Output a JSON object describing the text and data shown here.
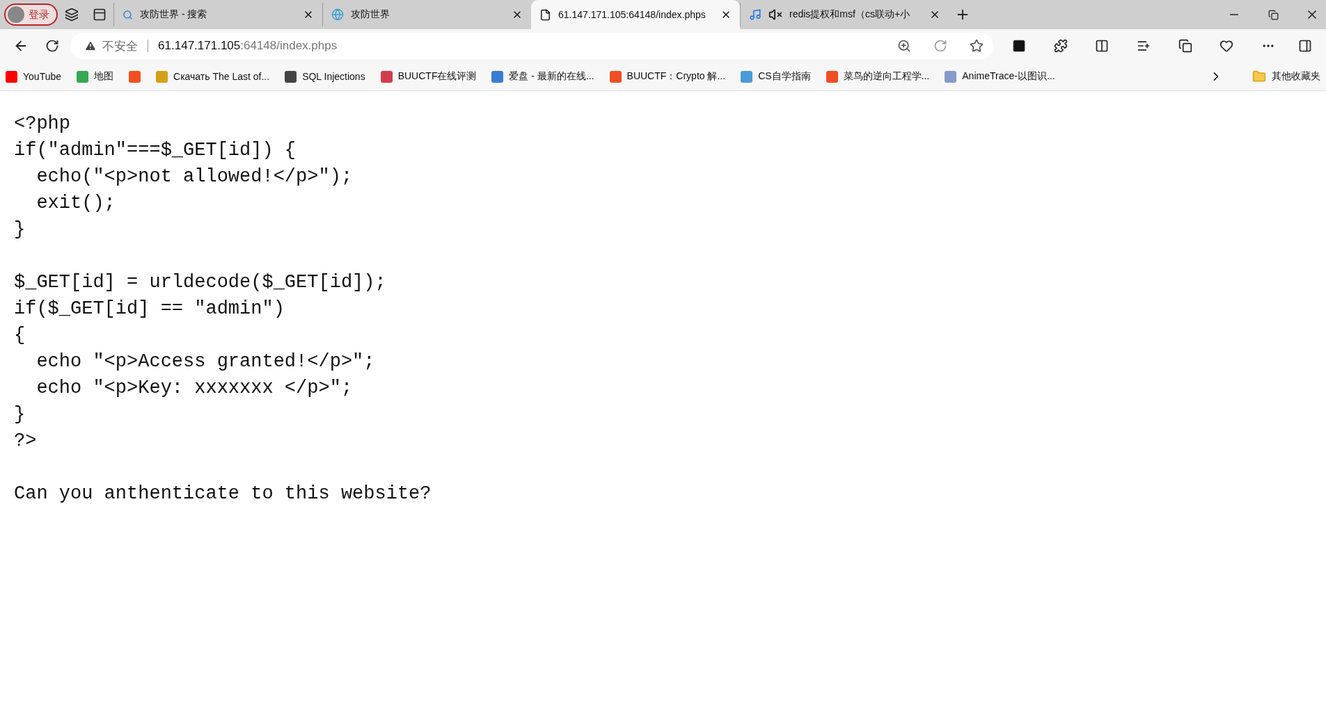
{
  "profile": {
    "label": "登录"
  },
  "tabs": [
    {
      "title": "攻防世界 - 搜索",
      "kind": "search",
      "selected": false,
      "muted": false
    },
    {
      "title": "攻防世界",
      "kind": "globe",
      "selected": false,
      "muted": false
    },
    {
      "title": "61.147.171.105:64148/index.phps",
      "kind": "page",
      "selected": true,
      "muted": false
    },
    {
      "title": "redis提权和msf（cs联动+小",
      "kind": "media",
      "selected": false,
      "muted": true
    }
  ],
  "address_bar": {
    "security": "不安全",
    "host": "61.147.171.105",
    "path": ":64148/index.phps"
  },
  "bookmarks": [
    {
      "label": "YouTube",
      "color": "#ff0000"
    },
    {
      "label": "地图",
      "color": "#34a853"
    },
    {
      "color": "#f25022"
    },
    {
      "label": "Скачать The Last of...",
      "color": "#d4a017"
    },
    {
      "label": "SQL Injections",
      "color": "#444444"
    },
    {
      "label": "BUUCTF在线评测",
      "color": "#d23c4c"
    },
    {
      "label": "爱盘 - 最新的在线...",
      "color": "#3a7bd5"
    },
    {
      "label": "BUUCTF：Crypto 解...",
      "color": "#f04e23"
    },
    {
      "label": "CS自学指南",
      "color": "#4a9bd8"
    },
    {
      "label": "菜鸟的逆向工程学...",
      "color": "#f04e23"
    },
    {
      "label": "AnimeTrace-以图识...",
      "color": "#8899cc"
    }
  ],
  "other_bookmarks": "其他收藏夹",
  "code_blocks": [
    {
      "lines": [
        "<?php",
        "if(\"admin\"===$_GET[id]) {",
        "  echo(\"<p>not allowed!</p>\");",
        "  exit();",
        "}"
      ]
    },
    {
      "lines": [
        "$_GET[id] = urldecode($_GET[id]);",
        "if($_GET[id] == \"admin\")",
        "{",
        "  echo \"<p>Access granted!</p>\";",
        "  echo \"<p>Key: xxxxxxx </p>\";",
        "}",
        "?>"
      ]
    }
  ],
  "message": "Can you anthenticate to this website?"
}
